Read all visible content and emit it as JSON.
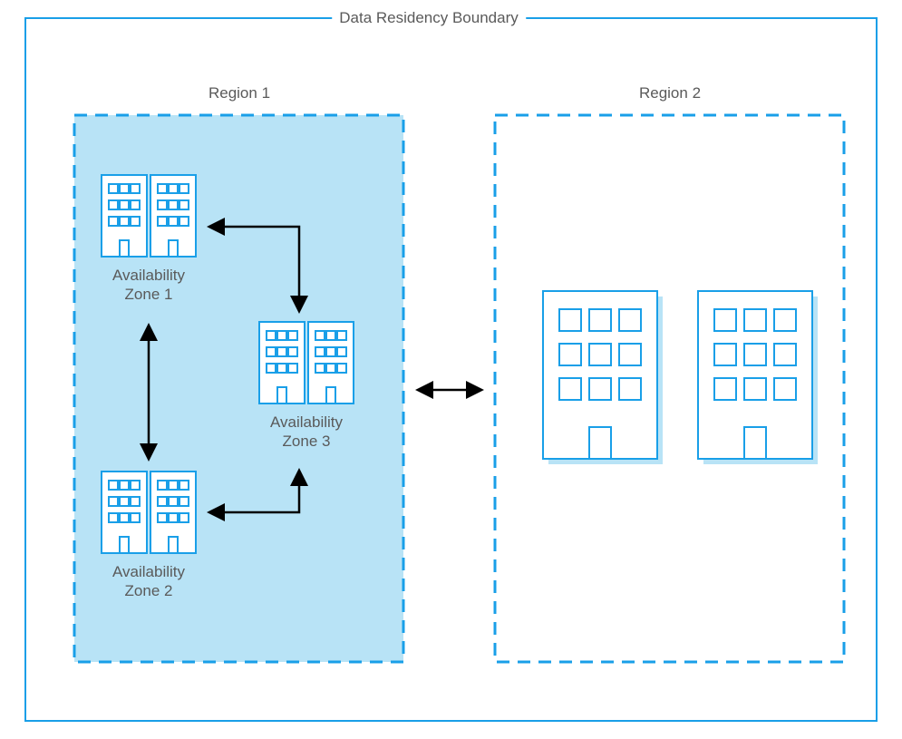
{
  "diagram": {
    "boundary_title": "Data Residency Boundary",
    "regions": [
      {
        "label": "Region 1",
        "zones": [
          {
            "label_line1": "Availability",
            "label_line2": "Zone 1"
          },
          {
            "label_line1": "Availability",
            "label_line2": "Zone 2"
          },
          {
            "label_line1": "Availability",
            "label_line2": "Zone 3"
          }
        ]
      },
      {
        "label": "Region 2"
      }
    ],
    "colors": {
      "azure_blue": "#199fe8",
      "region_fill": "#b8e3f6",
      "arrow_black": "#000000"
    }
  }
}
